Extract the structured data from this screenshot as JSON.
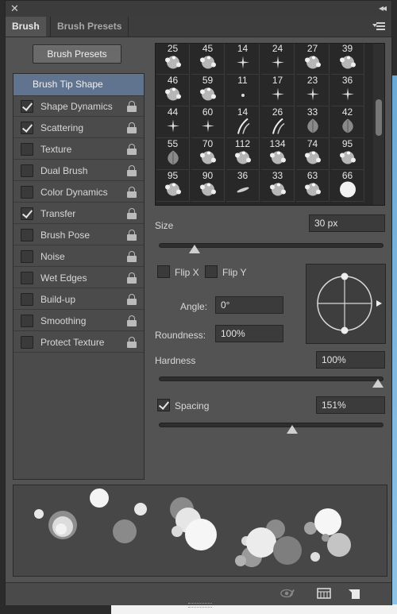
{
  "title_bar": {
    "close_glyph": "✕",
    "collapse_glyph": "◂◂"
  },
  "tabs": [
    {
      "label": "Brush"
    },
    {
      "label": "Brush Presets"
    }
  ],
  "presets_button": "Brush Presets",
  "left_list": {
    "header": "Brush Tip Shape",
    "items": [
      {
        "label": "Shape Dynamics",
        "checked": true
      },
      {
        "label": "Scattering",
        "checked": true
      },
      {
        "label": "Texture",
        "checked": false
      },
      {
        "label": "Dual Brush",
        "checked": false
      },
      {
        "label": "Color Dynamics",
        "checked": false
      },
      {
        "label": "Transfer",
        "checked": true
      },
      {
        "label": "Brush Pose",
        "checked": false
      },
      {
        "label": "Noise",
        "checked": false
      },
      {
        "label": "Wet Edges",
        "checked": false
      },
      {
        "label": "Build-up",
        "checked": false
      },
      {
        "label": "Smoothing",
        "checked": false
      },
      {
        "label": "Protect Texture",
        "checked": false
      }
    ]
  },
  "brush_grid": {
    "sizes": [
      [
        "25",
        "45",
        "14",
        "24",
        "27",
        "39"
      ],
      [
        "46",
        "59",
        "11",
        "17",
        "23",
        "36"
      ],
      [
        "44",
        "60",
        "14",
        "26",
        "33",
        "42"
      ],
      [
        "55",
        "70",
        "112",
        "134",
        "74",
        "95"
      ],
      [
        "95",
        "90",
        "36",
        "33",
        "63",
        "66"
      ]
    ]
  },
  "size": {
    "label": "Size",
    "value": "30 px",
    "slider_fraction": 0.14
  },
  "flip_x": {
    "label": "Flip X",
    "checked": false
  },
  "flip_y": {
    "label": "Flip Y",
    "checked": false
  },
  "angle": {
    "label": "Angle:",
    "value": "0°"
  },
  "roundness": {
    "label": "Roundness:",
    "value": "100%"
  },
  "hardness": {
    "label": "Hardness",
    "value": "100%",
    "slider_fraction": 1.0
  },
  "spacing": {
    "label": "Spacing",
    "value": "151%",
    "checked": true,
    "slider_fraction": 0.6
  },
  "bottom_icons": [
    "eye-brush-icon",
    "grid-panel-icon",
    "new-preset-icon"
  ]
}
